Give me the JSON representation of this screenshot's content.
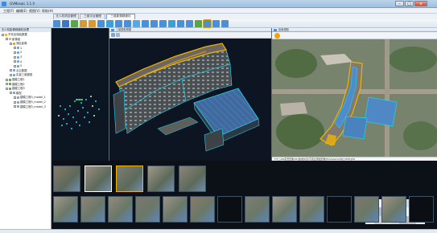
{
  "window": {
    "title": "GVMosaic 1.1.0",
    "controls": {
      "minimize": "–",
      "maximize": "□",
      "close": "x"
    }
  },
  "menu": {
    "items": [
      "工程(F)",
      "编辑(E)",
      "视图(V)",
      "帮助(H)"
    ]
  },
  "tabs": [
    {
      "label": "无人机项目管理",
      "active": false
    },
    {
      "label": "三维平台管理",
      "active": false
    },
    {
      "label": "三维影像精细化",
      "active": true
    }
  ],
  "toolbar": {
    "buttons": [
      {
        "name": "open-icon",
        "color": "#4b8fd8"
      },
      {
        "name": "save-icon",
        "color": "#3b78c2"
      },
      {
        "name": "import-icon",
        "color": "#5aa34a"
      },
      {
        "name": "undo-icon",
        "color": "#d79a2b"
      },
      {
        "name": "redo-icon",
        "color": "#d79a2b"
      },
      {
        "name": "camera-icon",
        "color": "#4b8fd8"
      },
      {
        "name": "select-icon",
        "color": "#3aa0d8"
      },
      {
        "name": "rotate-icon",
        "color": "#4b8fd8"
      },
      {
        "name": "pan-icon",
        "color": "#4b8fd8"
      },
      {
        "name": "zoom-icon",
        "color": "#55a9e6"
      },
      {
        "name": "measure-icon",
        "color": "#4b8fd8"
      },
      {
        "name": "texture-icon",
        "color": "#4b8fd8"
      },
      {
        "name": "mesh-icon",
        "color": "#4b8fd8"
      },
      {
        "name": "image-icon",
        "color": "#3aa0d8"
      },
      {
        "name": "layer-icon",
        "color": "#4b8fd8"
      },
      {
        "name": "snap-icon",
        "color": "#4b8fd8"
      },
      {
        "name": "map-icon",
        "color": "#5aa34a"
      },
      {
        "name": "grid-icon",
        "color": "#4b8fd8"
      },
      {
        "name": "split-icon",
        "color": "#4b8fd8"
      },
      {
        "name": "settings-icon",
        "color": "#4b8fd8"
      }
    ]
  },
  "tree": {
    "panel_title": "无人机影像精细化处理",
    "items": [
      {
        "label": "不完全测绘数据",
        "level": 0,
        "icon": "folder-icon",
        "color": "#e6b33a"
      },
      {
        "label": "影像组",
        "level": 1,
        "icon": "folder-icon",
        "color": "#e6b33a"
      },
      {
        "label": "测区影像",
        "level": 2,
        "icon": "image-icon",
        "color": "#d4a12a"
      },
      {
        "label": "1",
        "level": 3,
        "icon": "leaf-icon",
        "color": "#62a6e0"
      },
      {
        "label": "2",
        "level": 3,
        "icon": "leaf-icon",
        "color": "#62a6e0"
      },
      {
        "label": "3",
        "level": 3,
        "icon": "leaf-icon",
        "color": "#62a6e0"
      },
      {
        "label": "4",
        "level": 3,
        "icon": "leaf-icon",
        "color": "#62a6e0"
      },
      {
        "label": "5",
        "level": 3,
        "icon": "leaf-icon",
        "color": "#62a6e0"
      },
      {
        "label": "点云数据",
        "level": 2,
        "icon": "cloud-icon",
        "color": "#7aa0c8"
      },
      {
        "label": "实景三维模型",
        "level": 2,
        "icon": "model-icon",
        "color": "#7aa0c8"
      },
      {
        "label": "建模工程1",
        "level": 1,
        "icon": "project-icon",
        "color": "#5aa34a"
      },
      {
        "label": "建模工程2",
        "level": 1,
        "icon": "project-icon",
        "color": "#5aa34a"
      },
      {
        "label": "建模工程3",
        "level": 1,
        "icon": "project-icon",
        "color": "#5aa34a"
      },
      {
        "label": "模型",
        "level": 2,
        "icon": "model-icon",
        "color": "#7aa0c8"
      },
      {
        "label": "建模工程3_model_1",
        "level": 3,
        "icon": "model-icon",
        "color": "#7aa0c8"
      },
      {
        "label": "建模工程3_model_2",
        "level": 3,
        "icon": "model-icon",
        "color": "#7aa0c8"
      },
      {
        "label": "建模工程3_model_3",
        "level": 3,
        "icon": "model-icon",
        "color": "#7aa0c8"
      }
    ]
  },
  "views": {
    "model": {
      "title": "三维模型视图"
    },
    "aerial": {
      "title": "影像视图",
      "status": "F:\\F_UAV实景影像\\40 拍\\杭州某\\不完全测绘影像\\PhotoAerial\\DJI_0093.JPG"
    }
  },
  "filmstrip": {
    "row1_count": 5,
    "row2_count": 14
  }
}
